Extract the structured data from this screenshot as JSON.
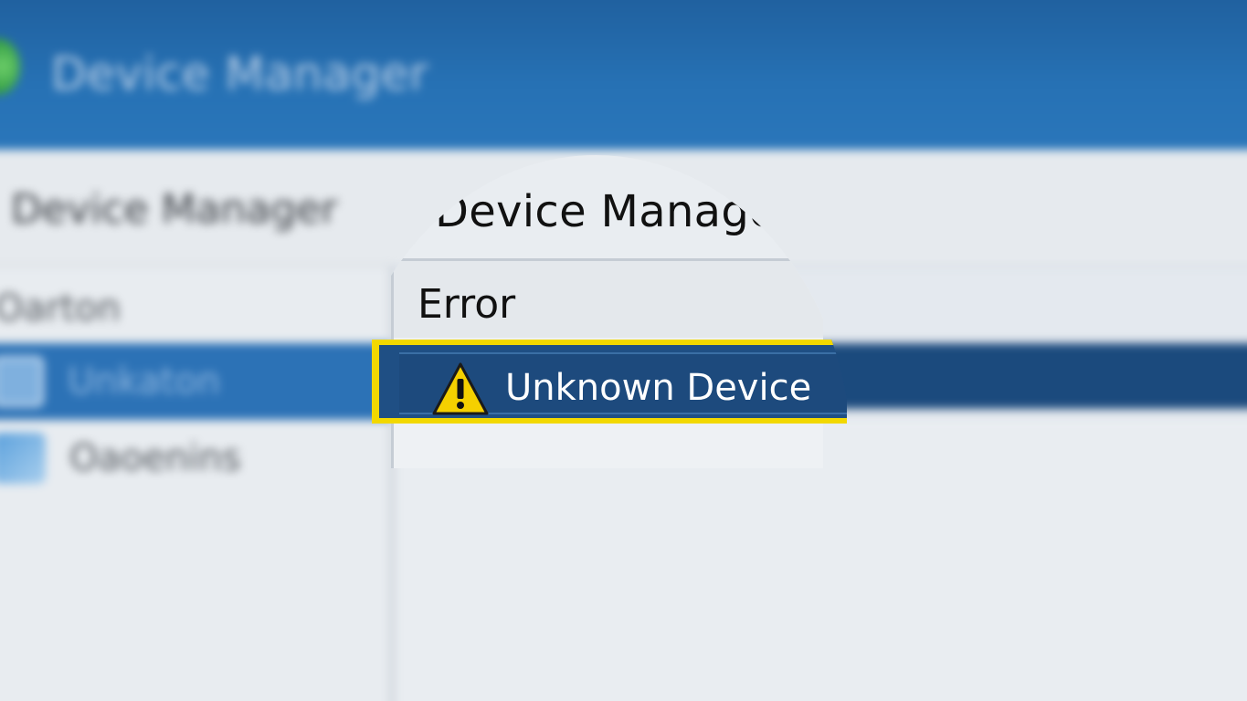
{
  "window": {
    "title": "Device Manager"
  },
  "menubar": {
    "title": "Device Manager"
  },
  "sidebar": {
    "items": [
      {
        "label": "Oarton"
      },
      {
        "label": "Unkaton",
        "selected": true,
        "icon": "monitor-icon"
      },
      {
        "label": "Oaoenins",
        "icon": "network-icon"
      }
    ]
  },
  "magnifier": {
    "title": "Device Manager",
    "category": "Error",
    "selected_device": {
      "label": "Unknown Device",
      "icon": "warning-icon"
    }
  },
  "colors": {
    "titlebar": "#2671b4",
    "selection": "#1f4f84",
    "highlight_outline": "#f2d800",
    "warning": "#f5d000"
  }
}
